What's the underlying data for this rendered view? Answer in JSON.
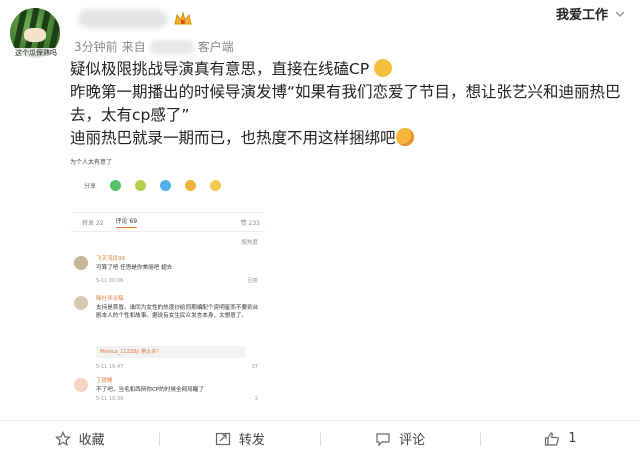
{
  "header": {
    "avatar_caption": "这个瓜保熟吗",
    "meta_time": "3分钟前",
    "meta_from": "来自",
    "meta_client": "客户端",
    "watermark": "我爱工作"
  },
  "post": {
    "lines": [
      "疑似极限挑战导演真有意思，直接在线磕CP",
      "昨晚第一期播出的时候导演发博“如果有我们恋爱了节目，想让张艺兴和迪丽热巴去，太有cp感了”",
      "迪丽热巴就录一期而已，也热度不用这样捆绑吧"
    ],
    "emoji": [
      "cat-emoji",
      "blush-emoji"
    ]
  },
  "screenshot": {
    "title": "为个人太有意了",
    "share_label": "分享",
    "tab_repost": "转发 22",
    "tab_comment": "评论 69",
    "tab_like": "赞 233",
    "sort_left": "",
    "sort_right": "按热度",
    "comments": [
      {
        "name": "飞天流月99",
        "text": "可算了吧 任思是你美丽吧 翅去",
        "time": "5-11 00:06",
        "likes": "回复"
      },
      {
        "name": "降社评论稿",
        "text": "支持是首冒。谁同为女性的热度炒给同期编配个资明星而不要到台剧本人的个性和故事。据说有女生民众发言本身，太想意了。",
        "quote": "Monica_1122BJ: 带太多?",
        "time": "5-11 16:47",
        "likes": "37"
      },
      {
        "name": "丁提睡",
        "text": "不了吧，当毛和西辩你CP的时候全网骂醒了",
        "time": "5-11 10:39",
        "likes": "2"
      }
    ]
  },
  "actions": {
    "favorite": "收藏",
    "repost": "转发",
    "comment": "评论",
    "like_count": "1"
  },
  "colors": {
    "accent": "#f27d2a",
    "text": "#222222",
    "meta": "#8a8a8a"
  }
}
